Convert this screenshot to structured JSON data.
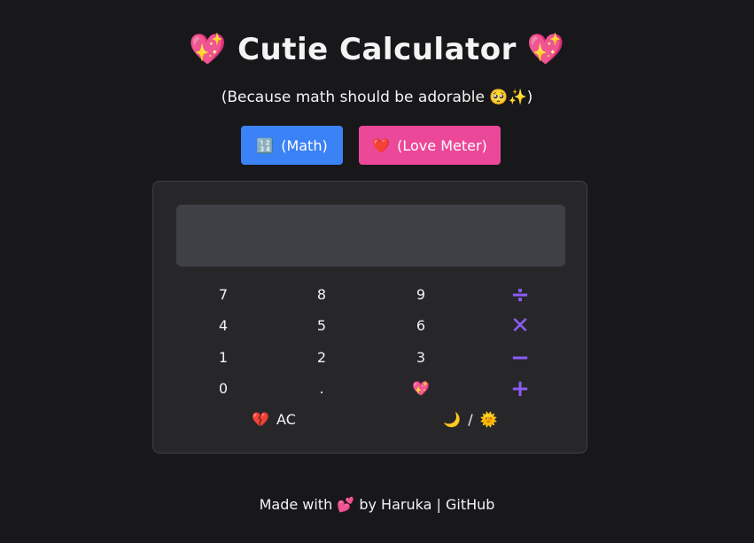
{
  "header": {
    "title": "Cutie Calculator",
    "title_emoji_left": "💖",
    "title_emoji_right": "💖",
    "subtitle": "(Because math should be adorable 🥺✨)"
  },
  "modes": {
    "math_icon": "🔢",
    "math_label": "(Math)",
    "love_icon": "❤️",
    "love_label": "(Love Meter)"
  },
  "display": {
    "value": ""
  },
  "keys": {
    "k7": "7",
    "k8": "8",
    "k9": "9",
    "divide": "÷",
    "k4": "4",
    "k5": "5",
    "k6": "6",
    "multiply": "✕",
    "k1": "1",
    "k2": "2",
    "k3": "3",
    "subtract": "−",
    "k0": "0",
    "dot": ".",
    "equals": "💖",
    "add": "+",
    "clear_icon": "💔",
    "clear_label": "AC",
    "theme_moon": "🌙",
    "theme_sep": "/",
    "theme_sun": "🌞"
  },
  "footer": {
    "made_with": "Made with",
    "heart": "💕",
    "by": "by Haruka",
    "sep": "|",
    "github": "GitHub"
  },
  "colors": {
    "background": "#18181b",
    "panel": "#27272a",
    "display": "#3f3f46",
    "math_button": "#3b82f6",
    "love_button": "#ec4899",
    "operator": "#8b5cf6"
  }
}
